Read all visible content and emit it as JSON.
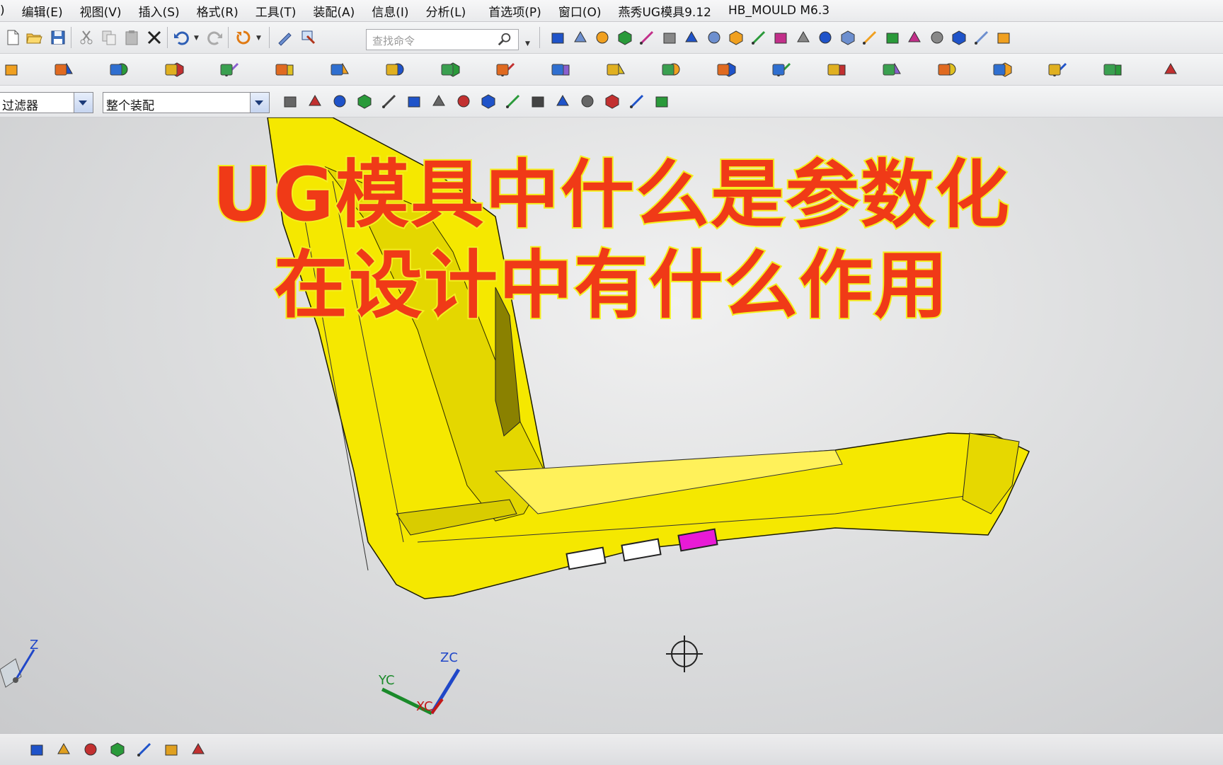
{
  "menubar": {
    "items": [
      ")",
      "编辑(E)",
      "视图(V)",
      "插入(S)",
      "格式(R)",
      "工具(T)",
      "装配(A)",
      "信息(I)",
      "分析(L)",
      "首选项(P)",
      "窗口(O)",
      "燕秀UG模具9.12",
      "HB_MOULD M6.3"
    ]
  },
  "toolbar": {
    "search_placeholder": "查找命令",
    "filter_combo": "过滤器",
    "assembly_combo": "整个装配"
  },
  "overlay": {
    "title_line1": "UG模具中什么是参数化",
    "title_line2": "在设计中有什么作用"
  },
  "viewport": {
    "axis_labels": {
      "z": "Z",
      "zc": "ZC",
      "yc": "YC",
      "xc": "XC"
    },
    "part_color": "#f5e800",
    "highlight_color": "#e81ad6"
  },
  "icons": {
    "toolbar1": [
      "new-icon",
      "open-icon",
      "save-icon",
      "cut-icon",
      "copy-icon",
      "paste-icon",
      "delete-icon",
      "undo-icon",
      "redo-icon",
      "repeat-icon",
      "edit-object-icon",
      "display-icon",
      "fit-icon",
      "shade-icon",
      "iso-view-icon",
      "top-view-icon",
      "front-view-icon",
      "right-view-icon",
      "left-view-icon",
      "view-layout-icon",
      "frame-icon",
      "section-icon",
      "clip-icon",
      "measure-icon",
      "curve-icon",
      "spline-icon",
      "line-icon",
      "arc-icon",
      "text-icon",
      "fillet-icon",
      "offset-curve-icon",
      "project-icon",
      "bridge-icon"
    ],
    "toolbar2": [
      "assembly-icon",
      "component-icon",
      "move-icon",
      "mate-icon",
      "replace-icon",
      "array-icon",
      "mirror-icon",
      "explode-icon",
      "constraint-icon",
      "mold-wizard-icon",
      "part-icon",
      "workpiece-icon",
      "layout-icon",
      "cavity-icon",
      "insert-icon",
      "slider-icon",
      "lifter-icon",
      "ejector-icon",
      "cooling-icon",
      "gate-icon",
      "runner-icon",
      "electrode-icon"
    ],
    "toolbar3": [
      "snap-icon",
      "point-icon",
      "select-icon",
      "box-select-icon",
      "face-icon",
      "body-icon",
      "end-point-icon",
      "mid-point-icon",
      "control-point-icon",
      "intersection-icon",
      "center-icon",
      "quadrant-icon",
      "existing-point-icon",
      "on-curve-icon",
      "tangent-icon",
      "grid-icon"
    ]
  }
}
